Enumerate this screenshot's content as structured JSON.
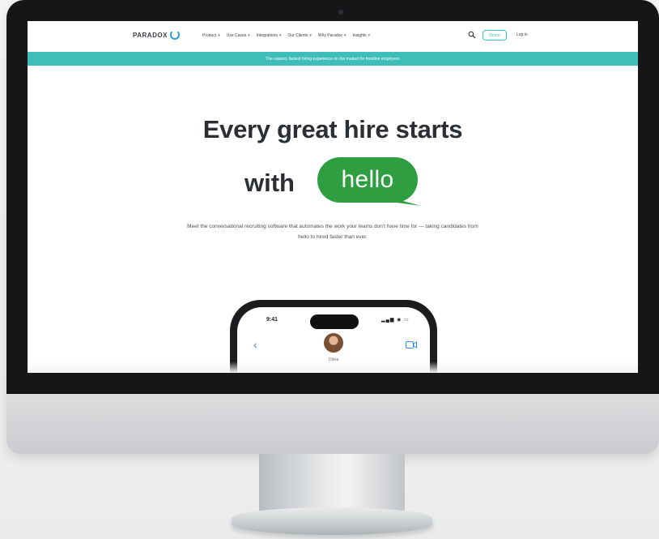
{
  "nav": {
    "logo_text": "PARADOX",
    "menu": [
      {
        "label": "Product"
      },
      {
        "label": "Use Cases"
      },
      {
        "label": "Integrations"
      },
      {
        "label": "Our Clients"
      },
      {
        "label": "Why Paradox"
      },
      {
        "label": "Insights"
      }
    ],
    "search_icon": "search-icon",
    "demo_label": "Demo",
    "login_label": "Log in"
  },
  "banner": {
    "text": "The easiest, fastest hiring experience on the market for frontline employers"
  },
  "hero": {
    "headline_line1": "Every great hire starts",
    "headline_with": "with",
    "hello": "hello",
    "subtext": "Meet the conversational recruiting software that automates the work your teams don't have time for — taking candidates from hello to hired faster than ever."
  },
  "phone": {
    "time": "9:41",
    "contact_name": "Olivia",
    "icons": [
      "back-chevron-icon",
      "video-call-icon",
      "signal-wifi-battery-icon"
    ]
  },
  "colors": {
    "teal": "#3ebdb9",
    "hello_green": "#2f9e41",
    "text_dark": "#2b2f33"
  }
}
